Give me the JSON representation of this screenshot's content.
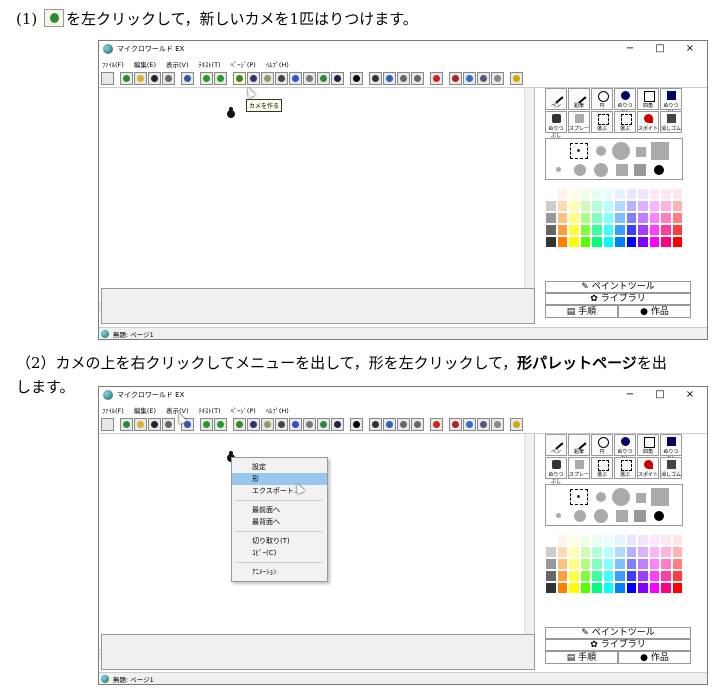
{
  "step1": {
    "prefix": "(1)",
    "suffix": "を左クリックして，新しいカメを1匹はりつけます。"
  },
  "step2": {
    "text_a": "（2）カメの上を右クリックしてメニューを出して，形を左クリックして，",
    "text_bold": "形パレットページ",
    "text_b": "を出",
    "text_c": "します。"
  },
  "window": {
    "title": "マイクロワールド EX",
    "controls": [
      "−",
      "□",
      "×"
    ],
    "menus": [
      "ﾌｧｲﾙ(F)",
      "編集(E)",
      "表示(V)",
      "ﾃｷｽﾄ(T)",
      "ﾍﾟｰｼﾞ(P)",
      "ﾍﾙﾌﾟ(H)"
    ],
    "status": "無題: ページ1",
    "tools_row1": [
      "ペン",
      "鉛筆",
      "円",
      "ぬりつぶし",
      "四角",
      "ぬりつぶし"
    ],
    "tools_row2": [
      "ぬりつぶし",
      "スプレー",
      "選ぶ",
      "選ぶ",
      "スポイト",
      "消しゴム"
    ],
    "side_buttons": {
      "paint": "ペイントツール",
      "library": "ライブラリ",
      "procedures": "手順",
      "works": "作品"
    }
  },
  "tooltip": "カメを作る",
  "context_menu": {
    "items_a": [
      "設定",
      "形",
      "エクスポート..."
    ],
    "items_b": [
      "最前面へ",
      "最背面へ"
    ],
    "items_c": [
      "切り取り(T)",
      "ｺﾋﾟｰ(C)"
    ],
    "items_d": [
      "ｱﾆﾒｰｼｮﾝ"
    ]
  },
  "colors": {
    "highlight": "#99c7f0",
    "palette": [
      "#ffffff",
      "#e0e0e0",
      "#c0c0c0",
      "#a0a0a0",
      "#808080",
      "#404040",
      "#000000",
      "#ffcccc",
      "#ffe0cc",
      "#ffffcc",
      "#ccffcc",
      "#ccffff",
      "#ccccff",
      "#ffccff",
      "#ff6666",
      "#ffb366",
      "#ffff66",
      "#66ff66",
      "#66ffff",
      "#6666ff",
      "#ff66ff",
      "#ff0000",
      "#ff8000",
      "#ffff00",
      "#00ff00",
      "#00ffff",
      "#0000ff",
      "#ff00ff"
    ]
  }
}
